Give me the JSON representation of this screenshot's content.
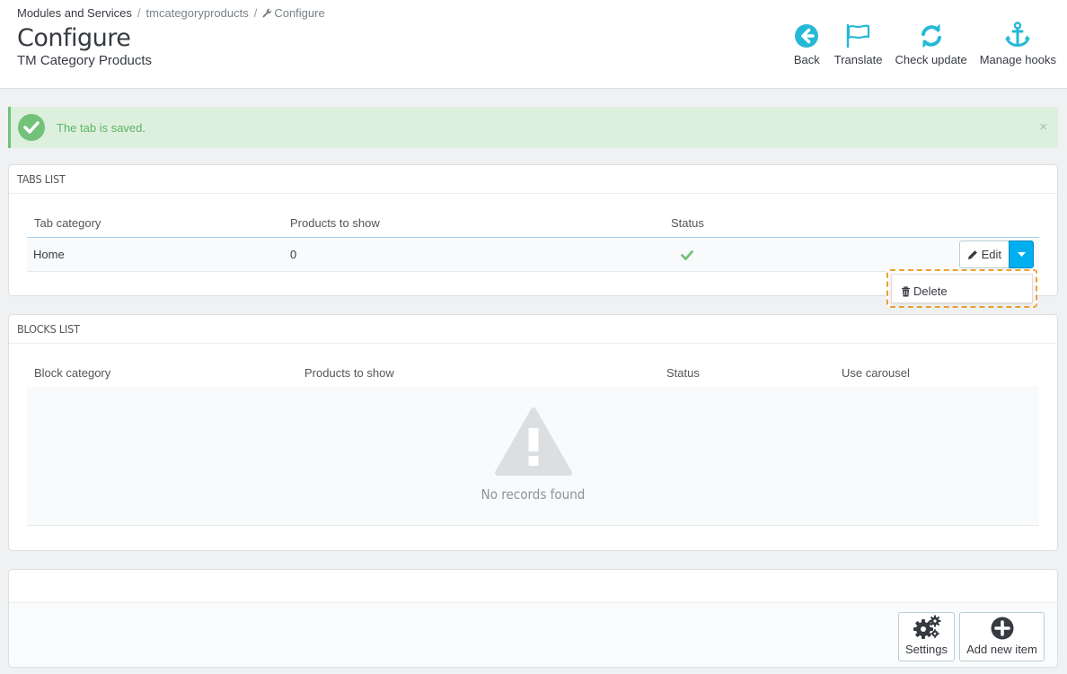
{
  "breadcrumb": {
    "root": "Modules and Services",
    "module": "tmcategoryproducts",
    "current": "Configure"
  },
  "header": {
    "title": "Configure",
    "subtitle": "TM Category Products"
  },
  "toolbar": {
    "back": "Back",
    "translate": "Translate",
    "check_update": "Check update",
    "manage_hooks": "Manage hooks"
  },
  "alert": {
    "message": "The tab is saved.",
    "close": "×"
  },
  "tabs_list": {
    "heading": "TABS LIST",
    "columns": [
      "Tab category",
      "Products to show",
      "Status"
    ],
    "rows": [
      {
        "category": "Home",
        "products": "0",
        "status": "enabled"
      }
    ],
    "edit_label": "Edit",
    "delete_label": "Delete"
  },
  "blocks_list": {
    "heading": "BLOCKS LIST",
    "columns": [
      "Block category",
      "Products to show",
      "Status",
      "Use carousel"
    ],
    "empty": "No records found"
  },
  "footer": {
    "settings": "Settings",
    "add_new": "Add new item"
  },
  "colors": {
    "accent": "#25b9d7",
    "success": "#72c279",
    "caret": "#00aff0",
    "highlight": "#f0a031"
  }
}
